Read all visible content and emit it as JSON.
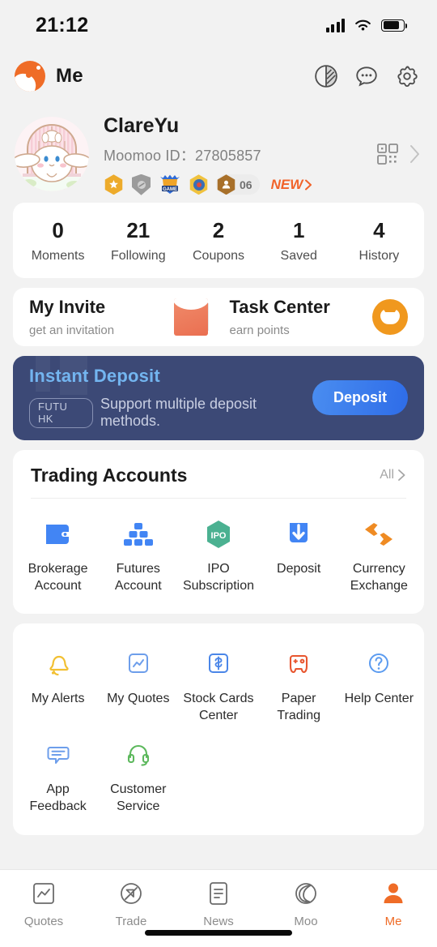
{
  "status_bar": {
    "time": "21:12",
    "signal_icon": "cellular-signal-icon",
    "wifi_icon": "wifi-icon",
    "battery_icon": "battery-icon"
  },
  "app_bar": {
    "title": "Me",
    "logo_icon": "moomoo-logo-icon",
    "icons": [
      {
        "name": "dark-mode-icon",
        "label": "Dark Mode"
      },
      {
        "name": "messages-icon",
        "label": "Messages"
      },
      {
        "name": "gear-icon",
        "label": "Settings"
      }
    ]
  },
  "profile": {
    "avatar_icon": "user-avatar",
    "username": "ClareYu",
    "moomoo_id_label": "Moomoo ID：27805857",
    "badges": [
      {
        "name": "star-badge"
      },
      {
        "name": "shield-badge"
      },
      {
        "name": "game-badge"
      },
      {
        "name": "medal-badge"
      }
    ],
    "fans_count": "06",
    "new_label": "NEW",
    "qr_icon": "qr-code-icon",
    "chevron_icon": "chevron-right-icon"
  },
  "stats": [
    {
      "value": "0",
      "label": "Moments"
    },
    {
      "value": "21",
      "label": "Following"
    },
    {
      "value": "2",
      "label": "Coupons"
    },
    {
      "value": "1",
      "label": "Saved"
    },
    {
      "value": "4",
      "label": "History"
    }
  ],
  "promos": [
    {
      "title": "My Invite",
      "subtitle": "get an invitation",
      "icon": "red-envelope-icon"
    },
    {
      "title": "Task Center",
      "subtitle": "earn points",
      "icon": "moo-mascot-icon"
    }
  ],
  "deposit_banner": {
    "title": "Instant Deposit",
    "tag": "FUTU HK",
    "description": "Support multiple deposit methods.",
    "button_label": "Deposit",
    "bg_color": "#3c4976",
    "title_color": "#73b5f0",
    "button_color": "#3a7aec"
  },
  "trading_accounts": {
    "title": "Trading Accounts",
    "all_label": "All",
    "chevron_icon": "chevron-right-icon",
    "items": [
      {
        "label": "Brokerage Account",
        "icon": "wallet-icon",
        "color": "#4285f4"
      },
      {
        "label": "Futures Account",
        "icon": "blocks-icon",
        "color": "#4285f4"
      },
      {
        "label": "IPO Subscription",
        "icon": "ipo-hexagon-icon",
        "color": "#4bb191"
      },
      {
        "label": "Deposit",
        "icon": "download-arrow-icon",
        "color": "#4285f4"
      },
      {
        "label": "Currency Exchange",
        "icon": "exchange-arrows-icon",
        "color": "#ef8b23"
      }
    ]
  },
  "services": [
    {
      "label": "My Alerts",
      "icon": "bell-icon",
      "color": "#f2c032"
    },
    {
      "label": "My Quotes",
      "icon": "chart-square-icon",
      "color": "#6d9eeb"
    },
    {
      "label": "Stock Cards Center",
      "icon": "dollar-square-icon",
      "color": "#4a86e8"
    },
    {
      "label": "Paper Trading",
      "icon": "gamepad-icon",
      "color": "#e8562f"
    },
    {
      "label": "Help Center",
      "icon": "question-icon",
      "color": "#5b9bf0"
    },
    {
      "label": "App Feedback",
      "icon": "feedback-icon",
      "color": "#6d9eeb"
    },
    {
      "label": "Customer Service",
      "icon": "headset-icon",
      "color": "#5cb85c"
    }
  ],
  "tab_bar": {
    "active": "Me",
    "active_color": "#ef6c27",
    "items": [
      {
        "label": "Quotes",
        "icon": "quotes-chart-icon"
      },
      {
        "label": "Trade",
        "icon": "trade-arrow-icon"
      },
      {
        "label": "News",
        "icon": "news-document-icon"
      },
      {
        "label": "Moo",
        "icon": "moo-circle-icon"
      },
      {
        "label": "Me",
        "icon": "person-icon"
      }
    ]
  }
}
